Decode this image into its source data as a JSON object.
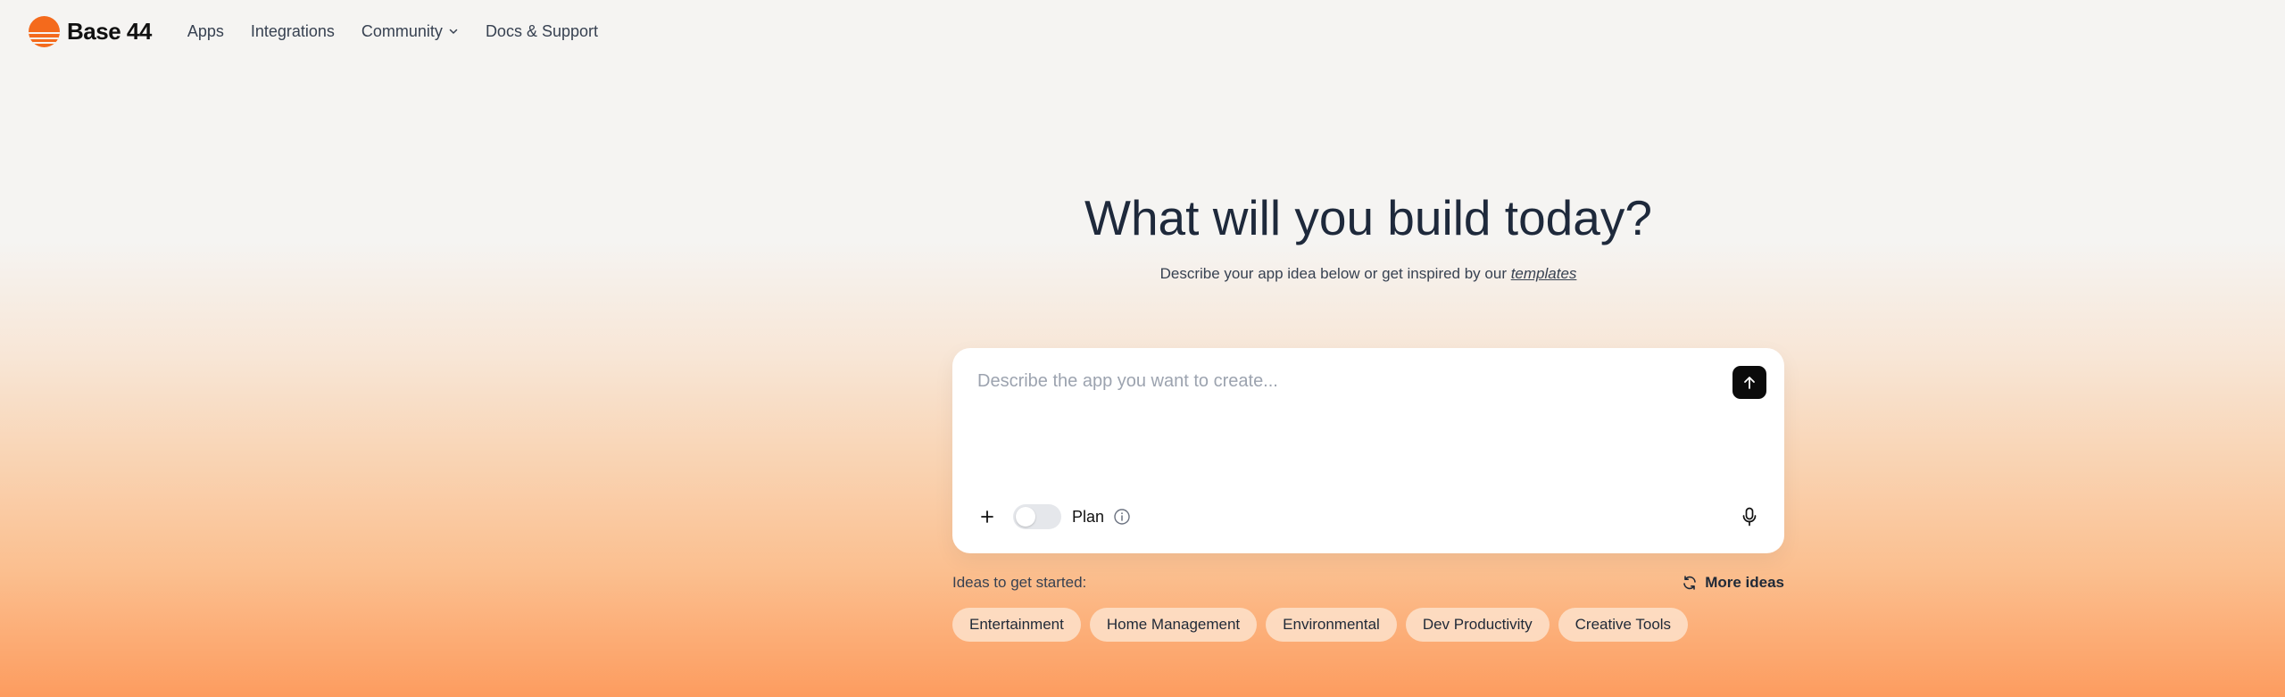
{
  "brand": {
    "name": "Base 44"
  },
  "nav": {
    "items": [
      {
        "label": "Apps"
      },
      {
        "label": "Integrations"
      },
      {
        "label": "Community",
        "has_dropdown": true
      },
      {
        "label": "Docs & Support"
      }
    ]
  },
  "hero": {
    "title": "What will you build today?",
    "subtitle_prefix": "Describe your app idea below or get inspired by our ",
    "subtitle_link": "templates"
  },
  "prompt": {
    "placeholder": "Describe the app you want to create...",
    "value": "",
    "plan_label": "Plan",
    "plan_enabled": false
  },
  "ideas": {
    "label": "Ideas to get started:",
    "more_label": "More ideas",
    "chips": [
      "Entertainment",
      "Home Management",
      "Environmental",
      "Dev Productivity",
      "Creative Tools"
    ]
  },
  "icons": {
    "send": "arrow-up-icon",
    "add": "plus-icon",
    "info": "info-icon",
    "mic": "microphone-icon",
    "refresh": "refresh-icon",
    "dropdown": "chevron-down-icon"
  },
  "colors": {
    "brand": "#f46a1c",
    "send_button": "#0b0b0b",
    "chip_bg": "#fde2cb"
  }
}
